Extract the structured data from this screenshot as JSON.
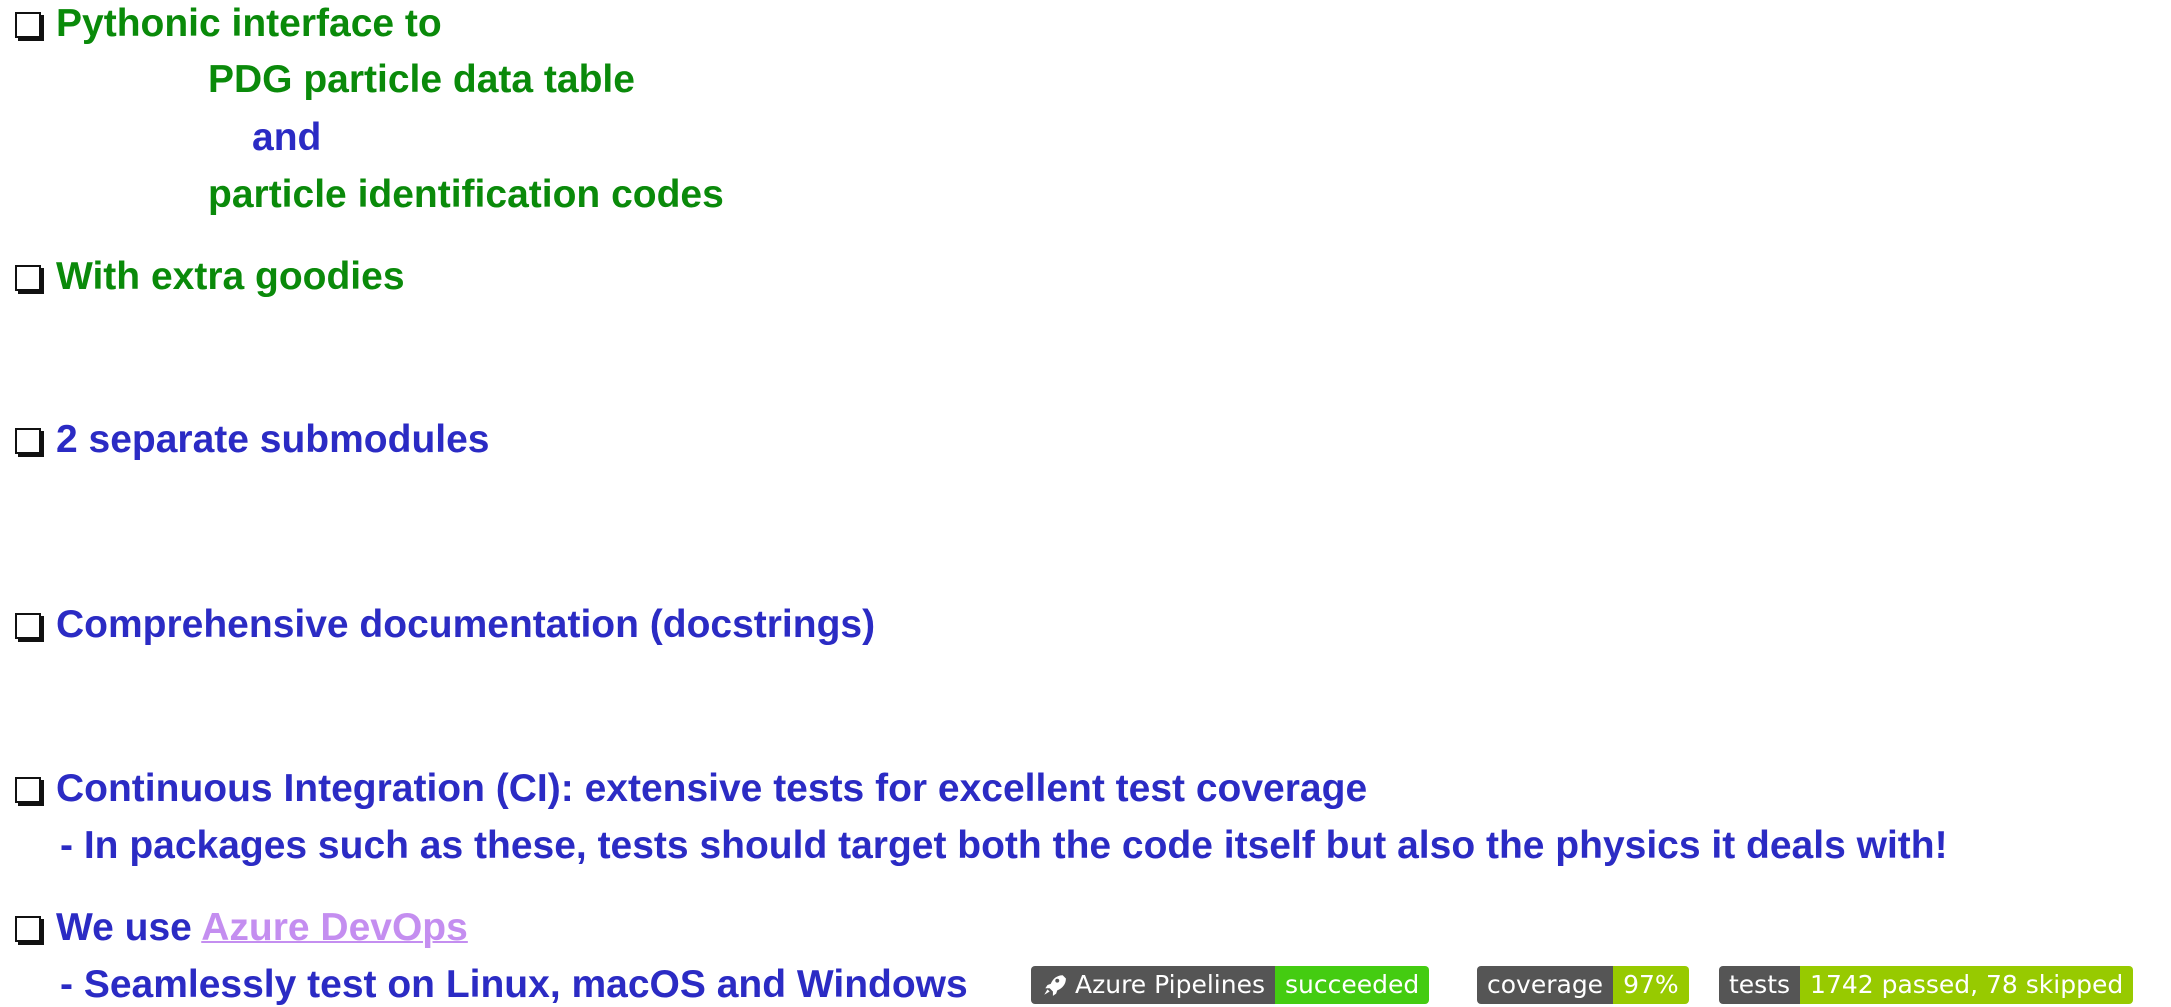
{
  "bullets": {
    "b1": "Pythonic interface to",
    "b1_sub1": "PDG particle data table",
    "b1_sub2": "and",
    "b1_sub3": "particle identification codes",
    "b2": "With extra goodies",
    "b3": "2 separate submodules",
    "b4": "Comprehensive documentation (docstrings)",
    "b5": "Continuous Integration (CI): extensive tests for excellent test coverage",
    "b5_sub": "- In packages such as these, tests should target both the code itself but also the physics it deals with!",
    "b6_prefix": "We use ",
    "b6_link": "Azure DevOps",
    "b6_sub": "- Seamlessly test on Linux, macOS and Windows"
  },
  "badges": {
    "pipelines": {
      "label": "Azure Pipelines",
      "value": "succeeded",
      "icon": "rocket-icon",
      "color": "#44cc11"
    },
    "coverage": {
      "label": "coverage",
      "value": "97%",
      "color": "#97ca00"
    },
    "tests": {
      "label": "tests",
      "value": "1742 passed, 78 skipped",
      "color": "#97ca00"
    }
  },
  "colors": {
    "green_text": "#0a8a0a",
    "blue_text": "#2b2bc4",
    "link": "#c48ef0"
  }
}
